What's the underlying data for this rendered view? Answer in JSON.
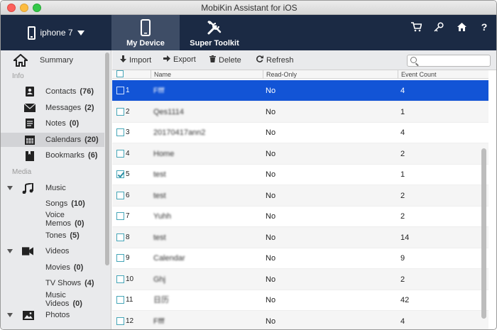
{
  "window": {
    "title": "MobiKin Assistant for iOS"
  },
  "device": {
    "name": "iphone 7"
  },
  "tabs": [
    {
      "label": "My Device",
      "icon": "phone-icon",
      "active": true
    },
    {
      "label": "Super Toolkit",
      "icon": "tools-icon",
      "active": false
    }
  ],
  "header_icons": [
    "cart-icon",
    "key-icon",
    "home-icon",
    "help-icon"
  ],
  "sidebar": {
    "summary": "Summary",
    "info_section": "Info",
    "info_items": [
      {
        "label": "Contacts",
        "count": "(76)"
      },
      {
        "label": "Messages",
        "count": "(2)"
      },
      {
        "label": "Notes",
        "count": "(0)"
      },
      {
        "label": "Calendars",
        "count": "(20)"
      },
      {
        "label": "Bookmarks",
        "count": "(6)"
      }
    ],
    "media_section": "Media",
    "music": "Music",
    "music_items": [
      {
        "label": "Songs",
        "count": "(10)"
      },
      {
        "label": "Voice Memos",
        "count": "(0)"
      },
      {
        "label": "Tones",
        "count": "(5)"
      }
    ],
    "videos": "Videos",
    "video_items": [
      {
        "label": "Movies",
        "count": "(0)"
      },
      {
        "label": "TV Shows",
        "count": "(4)"
      },
      {
        "label": "Music Videos",
        "count": "(0)"
      }
    ],
    "photos": "Photos"
  },
  "toolbar": {
    "import": "Import",
    "export": "Export",
    "delete": "Delete",
    "refresh": "Refresh",
    "search_placeholder": ""
  },
  "table": {
    "columns": [
      "Name",
      "Read-Only",
      "Event Count"
    ],
    "rows": [
      {
        "idx": "1",
        "name": "Ffff",
        "read_only": "No",
        "events": "4",
        "selected": true,
        "checked": false
      },
      {
        "idx": "2",
        "name": "Qes1114",
        "read_only": "No",
        "events": "1",
        "selected": false,
        "checked": false
      },
      {
        "idx": "3",
        "name": "20170417ann2",
        "read_only": "No",
        "events": "4",
        "selected": false,
        "checked": false
      },
      {
        "idx": "4",
        "name": "Home",
        "read_only": "No",
        "events": "2",
        "selected": false,
        "checked": false
      },
      {
        "idx": "5",
        "name": "test",
        "read_only": "No",
        "events": "1",
        "selected": false,
        "checked": true
      },
      {
        "idx": "6",
        "name": "test",
        "read_only": "No",
        "events": "2",
        "selected": false,
        "checked": false
      },
      {
        "idx": "7",
        "name": "Yuhh",
        "read_only": "No",
        "events": "2",
        "selected": false,
        "checked": false
      },
      {
        "idx": "8",
        "name": "test",
        "read_only": "No",
        "events": "14",
        "selected": false,
        "checked": false
      },
      {
        "idx": "9",
        "name": "Calendar",
        "read_only": "No",
        "events": "9",
        "selected": false,
        "checked": false
      },
      {
        "idx": "10",
        "name": "Ghj",
        "read_only": "No",
        "events": "2",
        "selected": false,
        "checked": false
      },
      {
        "idx": "11",
        "name": "日历",
        "read_only": "No",
        "events": "42",
        "selected": false,
        "checked": false
      },
      {
        "idx": "12",
        "name": "Ffff",
        "read_only": "No",
        "events": "4",
        "selected": false,
        "checked": false
      }
    ]
  }
}
